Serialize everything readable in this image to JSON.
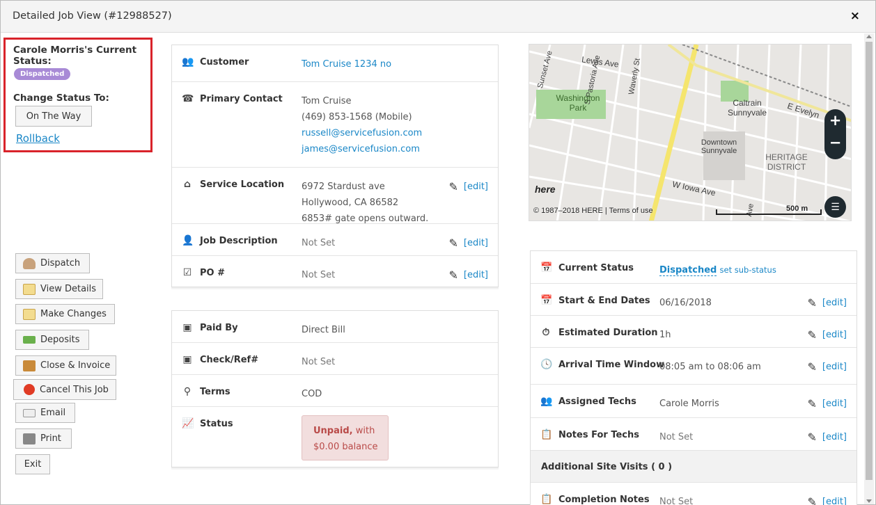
{
  "header": {
    "title": "Detailed Job View (#12988527)",
    "close_label": "×"
  },
  "status_box": {
    "heading": "Carole Morris's Current Status:",
    "badge": "Dispatched",
    "change_label": "Change Status To:",
    "on_the_way": "On The Way",
    "rollback": "Rollback"
  },
  "side_buttons": [
    {
      "label": "Dispatch",
      "icon": "person-icon",
      "color": "#c8a27c"
    },
    {
      "label": "View Details",
      "icon": "notepad-icon",
      "color": "#e8c46b"
    },
    {
      "label": "Make Changes",
      "icon": "pencil-notepad-icon",
      "color": "#e8c46b"
    },
    {
      "label": "Deposits",
      "icon": "money-icon",
      "color": "#6ab04c"
    },
    {
      "label": "Close & Invoice",
      "icon": "door-icon",
      "color": "#c98a3a"
    },
    {
      "label": "Cancel This Job",
      "icon": "stop-icon",
      "color": "#e03b24"
    },
    {
      "label": "Email",
      "icon": "envelope-icon",
      "color": "#b0b0b0"
    },
    {
      "label": "Print",
      "icon": "printer-icon",
      "color": "#777777"
    },
    {
      "label": "Exit",
      "icon": "",
      "color": ""
    }
  ],
  "customer_panel": {
    "customer_label": "Customer",
    "customer_value": "Tom Cruise 1234 no",
    "contact_label": "Primary Contact",
    "contact_name": "Tom Cruise",
    "contact_phone": "(469) 853-1568 (Mobile)",
    "contact_email1": "russell@servicefusion.com",
    "contact_email2": "james@servicefusion.com",
    "location_label": "Service Location",
    "location_line1": "6972 Stardust ave",
    "location_line2": "Hollywood, CA 86582",
    "location_line3": "6853# gate opens outward.",
    "description_label": "Job Description",
    "description_value": "Not Set",
    "po_label": "PO #",
    "po_value": "Not Set",
    "edit_label": "[edit]"
  },
  "billing_panel": {
    "paid_by_label": "Paid By",
    "paid_by_value": "Direct Bill",
    "check_label": "Check/Ref#",
    "check_value": "Not Set",
    "terms_label": "Terms",
    "terms_value": "COD",
    "status_label": "Status",
    "status_unpaid": "Unpaid,",
    "status_with": "with",
    "status_balance": "$0.00 balance"
  },
  "map": {
    "streets": [
      "Lewis Ave",
      "Sunset Ave",
      "S Pastoria Ave",
      "Waverly St",
      "E Evelyn",
      "W Iowa Ave",
      "Ave"
    ],
    "places": [
      "Washington Park",
      "Caltrain Sunnyvale",
      "Downtown Sunnyvale",
      "HERITAGE DISTRICT"
    ],
    "logo": "here",
    "copyright": "© 1987–2018 HERE | Terms of use",
    "scale": "500 m",
    "zoom_in": "+",
    "zoom_out": "−"
  },
  "job_panel": {
    "current_status_label": "Current Status",
    "current_status_value": "Dispatched",
    "sub_status": "set sub-status",
    "dates_label": "Start & End Dates",
    "dates_value": "06/16/2018",
    "duration_label": "Estimated Duration",
    "duration_value": "1h",
    "arrival_label": "Arrival Time Window",
    "arrival_value": "08:05 am to 08:06 am",
    "techs_label": "Assigned Techs",
    "techs_value": "Carole Morris",
    "notes_label": "Notes For Techs",
    "notes_value": "Not Set",
    "visits_label": "Additional Site Visits ( 0 )",
    "completion_label": "Completion Notes",
    "completion_value": "Not Set",
    "edit_label": "[edit]"
  }
}
